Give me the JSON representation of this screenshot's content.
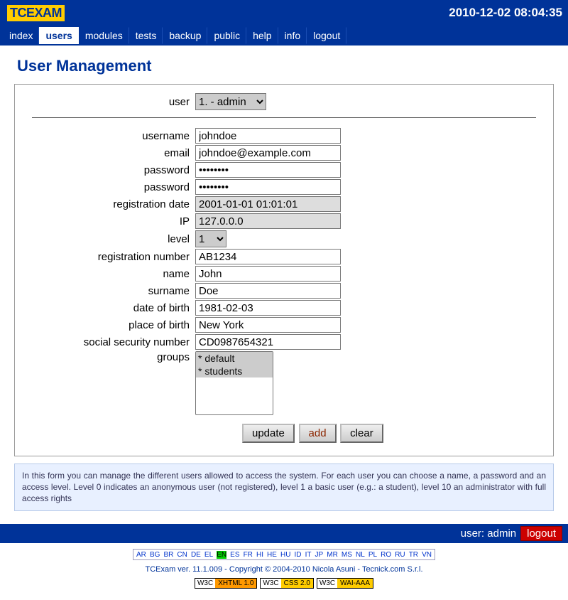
{
  "header": {
    "logo": "TCEXAM",
    "timestamp": "2010-12-02 08:04:35"
  },
  "nav": {
    "index": "index",
    "users": "users",
    "modules": "modules",
    "tests": "tests",
    "backup": "backup",
    "public": "public",
    "help": "help",
    "info": "info",
    "logout": "logout",
    "active": "users"
  },
  "page": {
    "title": "User Management"
  },
  "form": {
    "labels": {
      "user": "user",
      "username": "username",
      "email": "email",
      "password1": "password",
      "password2": "password",
      "regdate": "registration date",
      "ip": "IP",
      "level": "level",
      "regnum": "registration number",
      "name": "name",
      "surname": "surname",
      "dob": "date of birth",
      "pob": "place of birth",
      "ssn": "social security number",
      "groups": "groups"
    },
    "values": {
      "user_select": "1. - admin",
      "username": "johndoe",
      "email": "johndoe@example.com",
      "password1": "••••••••",
      "password2": "••••••••",
      "regdate": "2001-01-01 01:01:01",
      "ip": "127.0.0.0",
      "level": "1",
      "regnum": "AB1234",
      "name": "John",
      "surname": "Doe",
      "dob": "1981-02-03",
      "pob": "New York",
      "ssn": "CD0987654321"
    },
    "groups": {
      "opt1": "* default",
      "opt2": "* students"
    },
    "buttons": {
      "update": "update",
      "add": "add",
      "clear": "clear"
    }
  },
  "help": "In this form you can manage the different users allowed to access the system. For each user you can choose a name, a password and an access level. Level 0 indicates an anonymous user (not registered), level 1 a basic user (e.g.: a student), level 10 an administrator with full access rights",
  "bottom": {
    "userlabel": "user: admin",
    "logout": "logout"
  },
  "langs": {
    "AR": "AR",
    "BG": "BG",
    "BR": "BR",
    "CN": "CN",
    "DE": "DE",
    "EL": "EL",
    "EN": "EN",
    "ES": "ES",
    "FR": "FR",
    "HI": "HI",
    "HE": "HE",
    "HU": "HU",
    "ID": "ID",
    "IT": "IT",
    "JP": "JP",
    "MR": "MR",
    "MS": "MS",
    "NL": "NL",
    "PL": "PL",
    "RO": "RO",
    "RU": "RU",
    "TR": "TR",
    "VN": "VN"
  },
  "footer": {
    "tcexam_link": "TCExam",
    "version": " ver. 11.1.009 - Copyright © 2004-2010 Nicola Asuni - ",
    "tecnick_link": "Tecnick.com S.r.l.",
    "badge1a": "W3C",
    "badge1b": "XHTML 1.0",
    "badge2a": "W3C",
    "badge2b": "CSS 2.0",
    "badge3a": "W3C",
    "badge3b": "WAI-AAA"
  }
}
